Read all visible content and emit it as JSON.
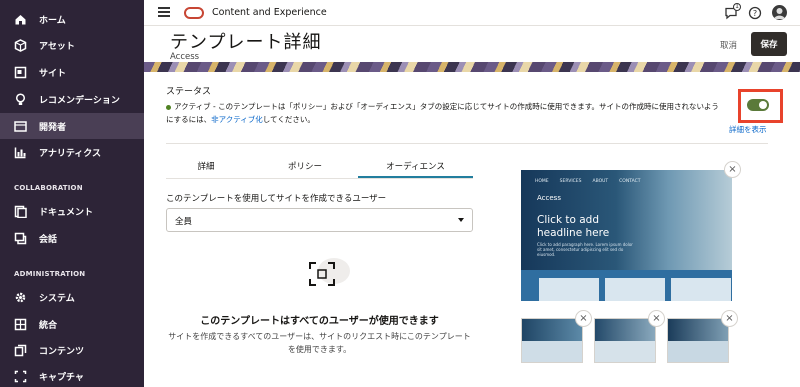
{
  "sidebar": {
    "items": [
      {
        "label": "ホーム",
        "icon": "home-icon"
      },
      {
        "label": "アセット",
        "icon": "cube-icon"
      },
      {
        "label": "サイト",
        "icon": "sites-icon"
      },
      {
        "label": "レコメンデーション",
        "icon": "lightbulb-icon"
      },
      {
        "label": "開発者",
        "icon": "developer-icon"
      },
      {
        "label": "アナリティクス",
        "icon": "analytics-icon"
      },
      {
        "label": "ドキュメント",
        "icon": "documents-icon"
      },
      {
        "label": "会話",
        "icon": "conversations-icon"
      },
      {
        "label": "システム",
        "icon": "gear-icon"
      },
      {
        "label": "統合",
        "icon": "integrations-icon"
      },
      {
        "label": "コンテンツ",
        "icon": "content-icon"
      },
      {
        "label": "キャプチャ",
        "icon": "capture-icon"
      }
    ],
    "sections": {
      "collaboration": "COLLABORATION",
      "administration": "ADMINISTRATION"
    }
  },
  "topbar": {
    "app_title": "Content and Experience",
    "notification_count": "1"
  },
  "header": {
    "title": "テンプレート詳細",
    "subtitle": "Access",
    "cancel_label": "取消",
    "save_label": "保存"
  },
  "status": {
    "label": "ステータス",
    "text_prefix": "アクティブ - このテンプレートは「ポリシー」および「オーディエンス」タブの設定に応じてサイトの作成時に使用できます。サイトの作成時に使用されないよう",
    "text_line2_prefix": "にするには、",
    "deactivate_link": "非アクティブ化",
    "text_suffix": "してください。",
    "details_link": "詳細を表示",
    "toggle_on": true
  },
  "tabs": [
    {
      "label": "詳細"
    },
    {
      "label": "ポリシー"
    },
    {
      "label": "オーディエンス"
    }
  ],
  "audience": {
    "field_label": "このテンプレートを使用してサイトを作成できるユーザー",
    "selected": "全員",
    "empty_title": "このテンプレートはすべてのユーザーが使用できます",
    "empty_desc": "サイトを作成できるすべてのユーザーは、サイトのリクエスト時にこのテンプレートを使用できます。"
  },
  "preview": {
    "nav": [
      "HOME",
      "SERVICES",
      "ABOUT",
      "CONTACT"
    ],
    "site_name": "Access",
    "headline": "Click to add headline here",
    "lorem": "Click to add paragraph here. Lorem ipsum dolor sit amet, consectetur adipiscing elit sed do eiusmod."
  },
  "colors": {
    "sidebar_bg": "#2d2437",
    "sidebar_active": "#4a3f55",
    "accent_tab": "#227e9e",
    "toggle_on": "#5a7a3a",
    "highlight_box": "#e8432c",
    "link": "#0a67c9",
    "oracle_red": "#c74634"
  }
}
